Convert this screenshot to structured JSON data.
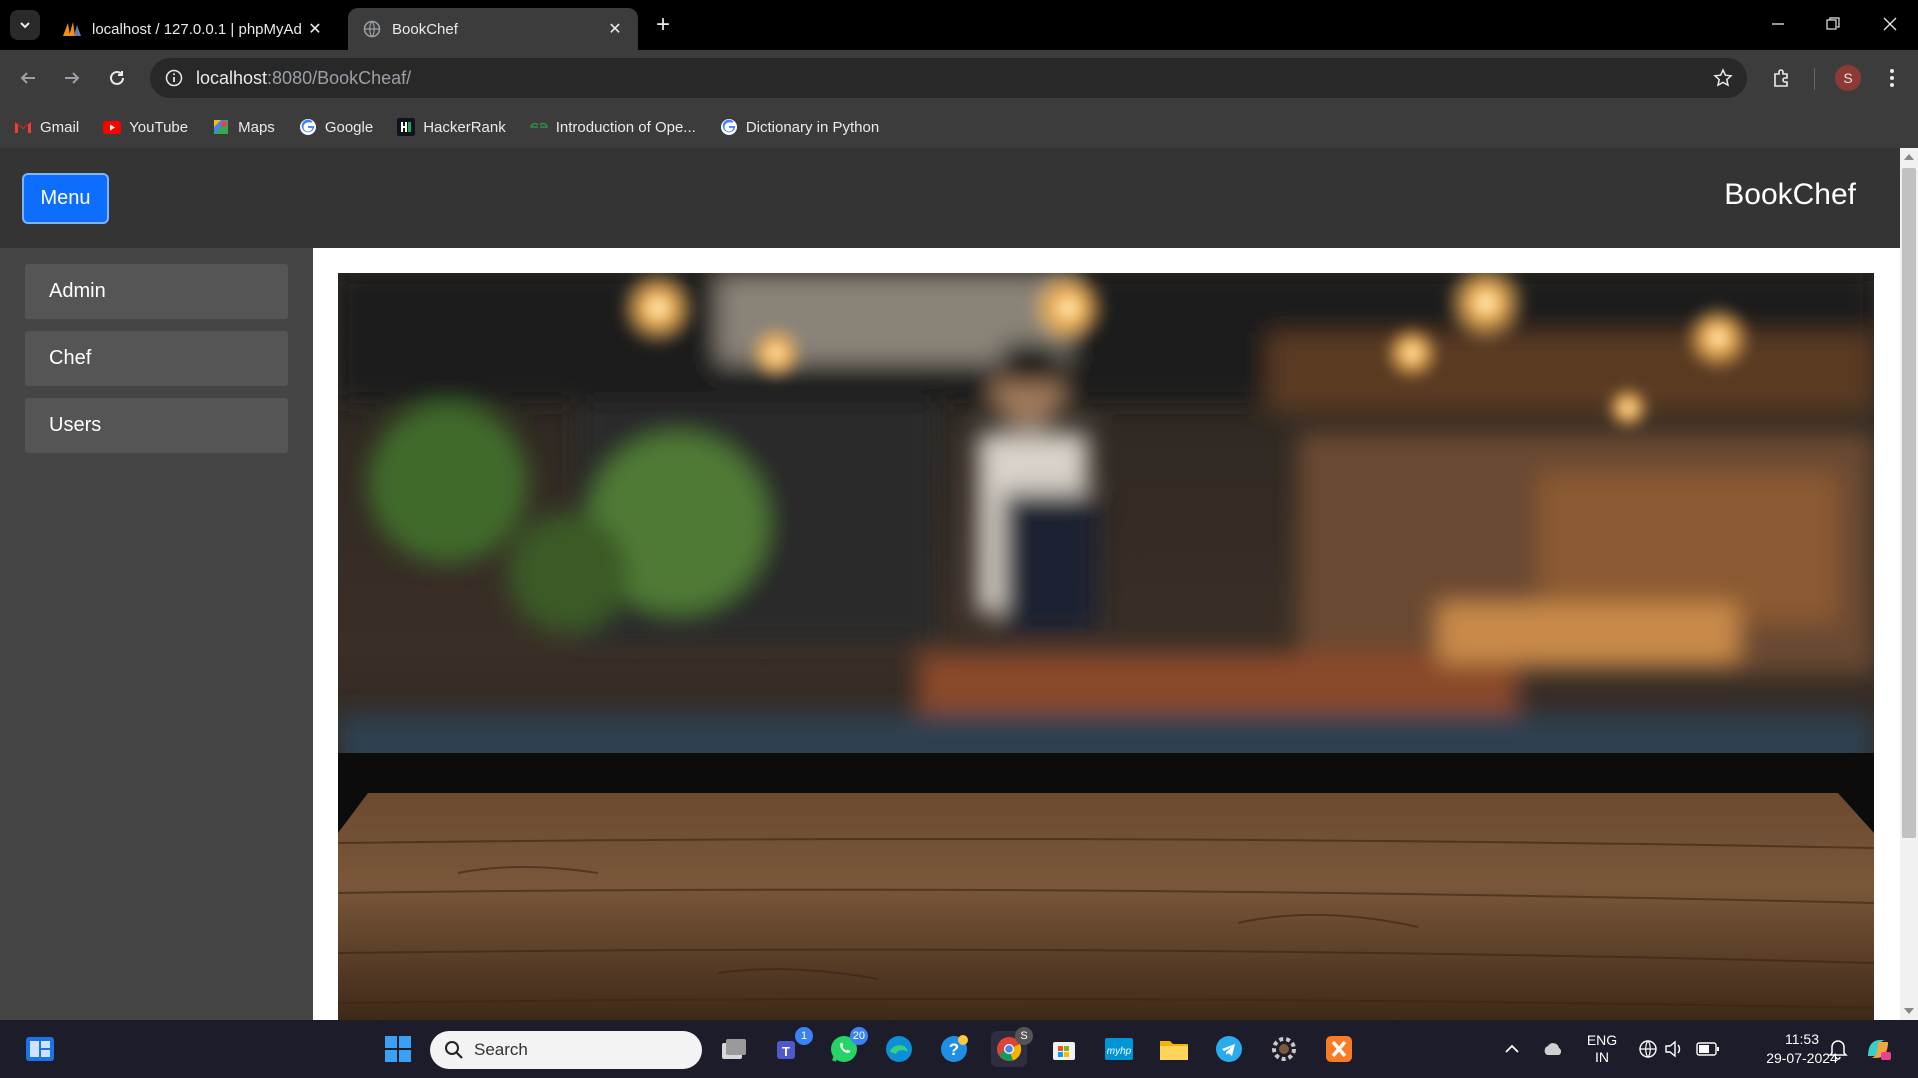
{
  "browser": {
    "tabs": [
      {
        "title": "localhost / 127.0.0.1 | phpMyAd",
        "active": false,
        "favicon": "phpmyadmin-icon"
      },
      {
        "title": "BookChef",
        "active": true,
        "favicon": "globe-icon"
      }
    ],
    "address": {
      "host": "localhost",
      "rest": ":8080/BookCheaf/"
    },
    "bookmarks": [
      {
        "label": "Gmail",
        "icon": "gmail-icon"
      },
      {
        "label": "YouTube",
        "icon": "youtube-icon"
      },
      {
        "label": "Maps",
        "icon": "maps-icon"
      },
      {
        "label": "Google",
        "icon": "google-icon"
      },
      {
        "label": "HackerRank",
        "icon": "hackerrank-icon"
      },
      {
        "label": "Introduction of Ope...",
        "icon": "geeksforgeeks-icon"
      },
      {
        "label": "Dictionary in Python",
        "icon": "google-icon"
      }
    ],
    "profile_initial": "S"
  },
  "page": {
    "menu_label": "Menu",
    "brand": "BookChef",
    "sidebar": [
      {
        "label": "Admin"
      },
      {
        "label": "Chef"
      },
      {
        "label": "Users"
      }
    ],
    "colors": {
      "header": "#343434",
      "sidebar": "#454545",
      "menu_button": "#0d6efd"
    }
  },
  "taskbar": {
    "search_placeholder": "Search",
    "teams_badge": "1",
    "whatsapp_badge": "20",
    "chrome_badge": "S",
    "language": {
      "line1": "ENG",
      "line2": "IN"
    },
    "time": "11:53",
    "date": "29-07-2024"
  }
}
